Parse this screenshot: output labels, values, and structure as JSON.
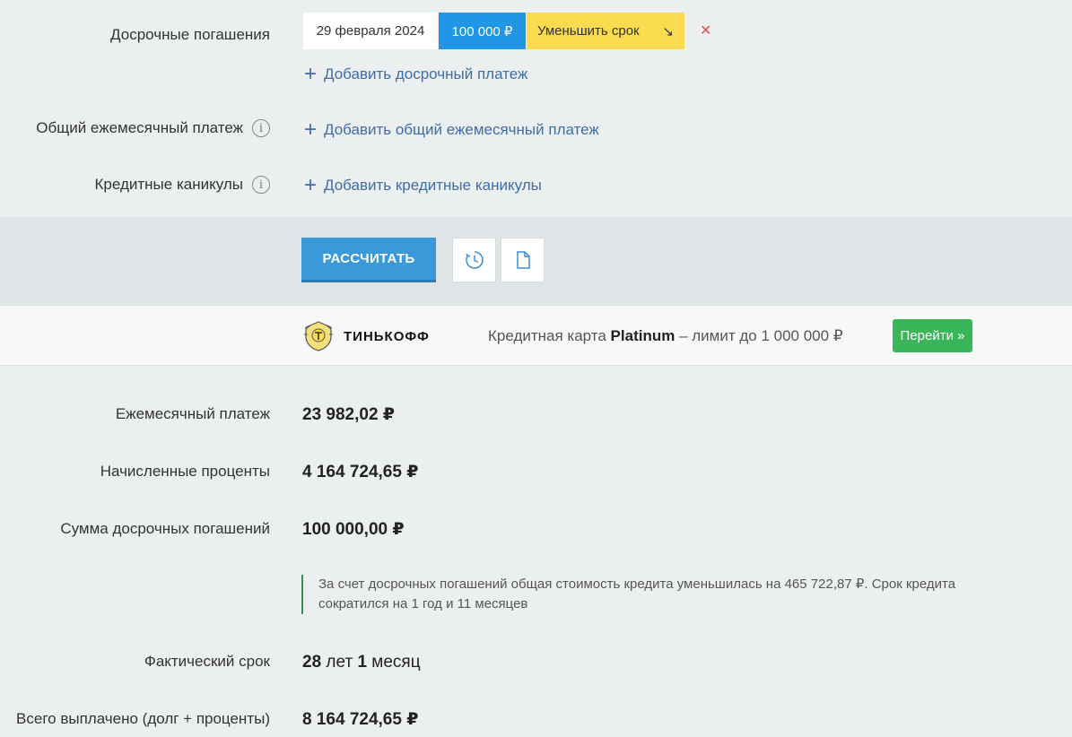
{
  "early": {
    "label": "Досрочные погашения",
    "payment": {
      "date": "29 февраля 2024",
      "amount": "100 000 ₽",
      "mode": "Уменьшить срок",
      "mode_arrow": "↘",
      "remove": "✕"
    },
    "add_label": "Добавить досрочный платеж"
  },
  "common": {
    "label": "Общий ежемесячный платеж",
    "add_label": "Добавить общий ежемесячный платеж"
  },
  "holidays": {
    "label": "Кредитные каникулы",
    "add_label": "Добавить кредитные каникулы"
  },
  "info_glyph": "i",
  "plus_glyph": "+",
  "actions": {
    "calculate": "РАССЧИТАТЬ",
    "history_icon": "clock-icon",
    "document_icon": "document-icon"
  },
  "ad": {
    "brand": "ТИНЬКОФФ",
    "text_prefix": "Кредитная карта",
    "text_bold": "Platinum",
    "text_suffix": "– лимит до 1 000 000 ₽",
    "button": "Перейти »",
    "button_color": "#3bb55a"
  },
  "results": {
    "monthly_label": "Ежемесячный платеж",
    "monthly_value": "23 982,02 ₽",
    "interest_label": "Начисленные проценты",
    "interest_value": "4 164 724,65 ₽",
    "early_sum_label": "Сумма досрочных погашений",
    "early_sum_value": "100 000,00 ₽",
    "note_line1": "За счет досрочных погашений общая стоимость кредита уменьшилась на 465 722,87 ₽. Срок кредита",
    "note_line2": "сократился на 1 год и 11 месяцев",
    "term_label": "Фактический срок",
    "term_years": "28",
    "term_years_word": "лет",
    "term_months": "1",
    "term_months_word": "месяц",
    "total_label": "Всего выплачено (долг + проценты)",
    "total_value": "8 164 724,65 ₽"
  },
  "colors": {
    "accent_blue": "#2196e6",
    "calc_blue": "#3a9ad9",
    "mode_yellow": "#fbdb4f",
    "remove_red": "#e54b4b",
    "link_blue": "#3f6ea6",
    "note_green": "#3f8a5a"
  }
}
